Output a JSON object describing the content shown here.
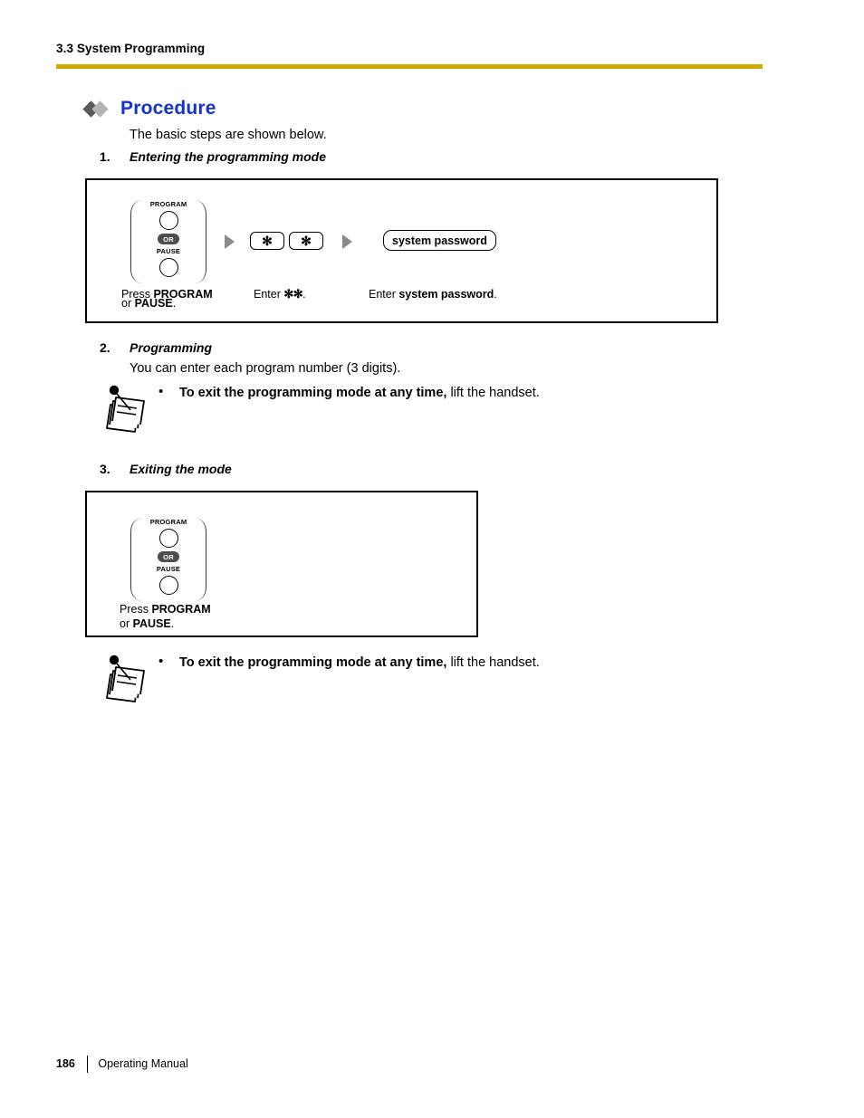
{
  "header": {
    "section_title": "3.3 System Programming",
    "rule_color": "#d4aa00"
  },
  "procedure": {
    "heading": "Procedure",
    "heading_color": "#1432d2",
    "intro": "The basic steps are shown below."
  },
  "steps": [
    {
      "number": "1.",
      "title": "Entering the programming mode",
      "body": ""
    },
    {
      "number": "2.",
      "title": "Programming",
      "body": "You can enter each program number (3 digits)."
    },
    {
      "number": "3.",
      "title": "Exiting the mode",
      "body": ""
    }
  ],
  "diagram1": {
    "cluster": {
      "program_label": "PROGRAM",
      "or_label": "OR",
      "pause_label": "PAUSE"
    },
    "asterisk_key_1": "✻",
    "asterisk_key_2": "✻",
    "password_box": "system password",
    "caption_press_1": "Press ",
    "caption_press_1_bold": "PROGRAM",
    "caption_press_2": "or ",
    "caption_press_2_bold": "PAUSE",
    "caption_press_2_end": ".",
    "caption_enter_prefix": "Enter ",
    "caption_enter_asterisks": "✻✻",
    "caption_enter_suffix": ".",
    "caption_password_prefix": "Enter ",
    "caption_password_bold": "system password",
    "caption_password_suffix": "."
  },
  "diagram2": {
    "cluster": {
      "program_label": "PROGRAM",
      "or_label": "OR",
      "pause_label": "PAUSE"
    },
    "caption_press_1": "Press ",
    "caption_press_1_bold": "PROGRAM",
    "caption_press_2": "or ",
    "caption_press_2_bold": "PAUSE",
    "caption_press_2_end": "."
  },
  "notes": [
    {
      "bullet": "•",
      "bold_text": "To exit the programming mode at any time,",
      "rest_text": " lift the handset."
    },
    {
      "bullet": "•",
      "bold_text": "To exit the programming mode at any time,",
      "rest_text": " lift the handset."
    }
  ],
  "footer": {
    "page_number": "186",
    "manual_name": "Operating Manual"
  }
}
